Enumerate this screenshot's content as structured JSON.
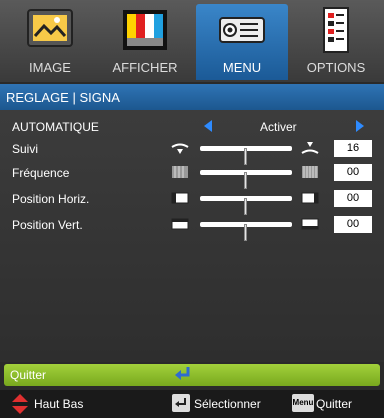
{
  "tabs": [
    {
      "label": "IMAGE",
      "icon": "image-icon",
      "active": false
    },
    {
      "label": "AFFICHER",
      "icon": "display-icon",
      "active": false
    },
    {
      "label": "MENU",
      "icon": "menu-icon",
      "active": true
    },
    {
      "label": "OPTIONS",
      "icon": "options-icon",
      "active": false
    }
  ],
  "section": {
    "title": "REGLAGE | SIGNA"
  },
  "rows": {
    "auto": {
      "label": "AUTOMATIQUE",
      "value": "Activer"
    },
    "suivi": {
      "label": "Suivi",
      "value": "16",
      "level": 0.5
    },
    "frequence": {
      "label": "Fréquence",
      "value": "00",
      "level": 0.5
    },
    "posh": {
      "label": "Position Horiz.",
      "value": "00",
      "level": 0.5
    },
    "posv": {
      "label": "Position Vert.",
      "value": "00",
      "level": 0.5
    }
  },
  "exit": {
    "label": "Quitter"
  },
  "footer": {
    "nav": "Haut Bas",
    "select": "Sélectionner",
    "menu_key": "Menu",
    "quit": "Quitter"
  },
  "colors": {
    "accent_blue": "#2e8bff",
    "exit_green": "#8fc02a"
  }
}
